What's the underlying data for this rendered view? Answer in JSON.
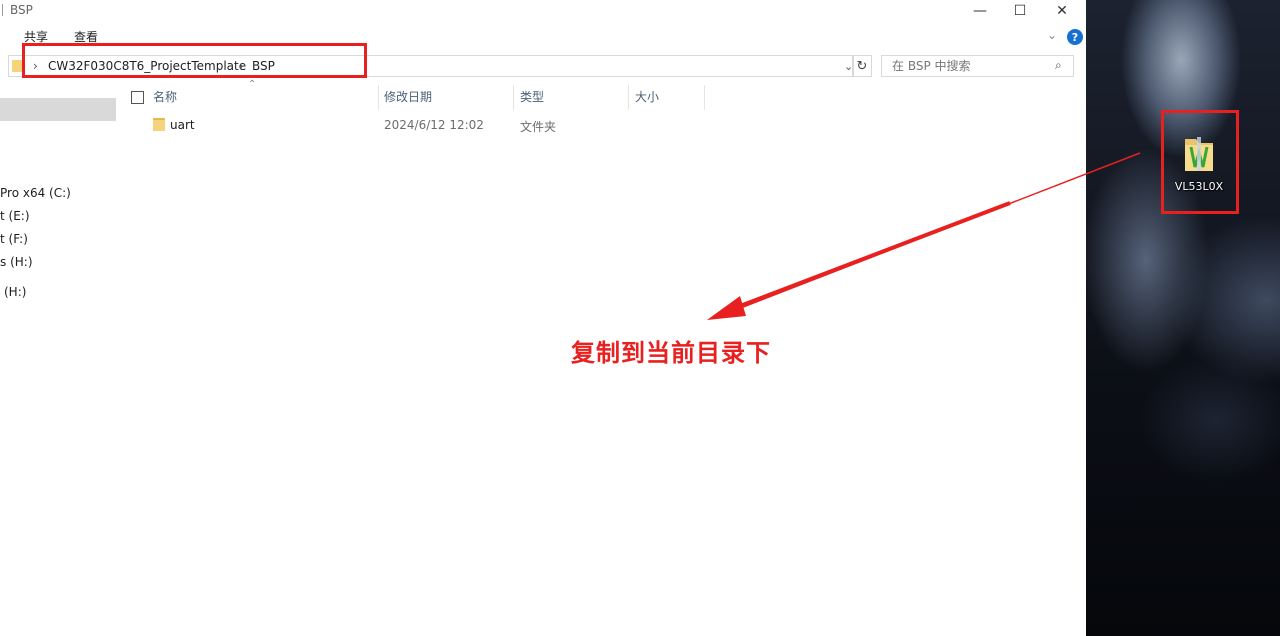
{
  "window": {
    "title": "BSP",
    "minimize_glyph": "—",
    "maximize_glyph": "☐",
    "close_glyph": "✕"
  },
  "ribbon": {
    "tabs": [
      "共享",
      "查看"
    ],
    "expand_glyph": "⌄",
    "help_glyph": "?"
  },
  "address": {
    "segments": [
      "CW32F030C8T6_ProjectTemplate",
      "BSP"
    ],
    "separator": "›",
    "dropdown_glyph": "⌄",
    "refresh_glyph": "↻"
  },
  "search": {
    "placeholder": "在 BSP 中搜索",
    "icon": "search-icon"
  },
  "nav": {
    "items": [
      "Pro x64 (C:)",
      "t (E:)",
      "t (F:)",
      "s (H:)",
      "(H:)"
    ]
  },
  "columns": [
    "名称",
    "修改日期",
    "类型",
    "大小"
  ],
  "sort_caret": "⌃",
  "files": [
    {
      "name": "uart",
      "modified": "2024/6/12 12:02",
      "type": "文件夹",
      "size": ""
    }
  ],
  "desktop": {
    "icon_label": "VL53L0X"
  },
  "annotation": {
    "text": "复制到当前目录下",
    "color": "#e8201f"
  },
  "colors": {
    "highlight": "#e8201f",
    "folder": "#f5d37a",
    "header_text": "#4c607a"
  }
}
